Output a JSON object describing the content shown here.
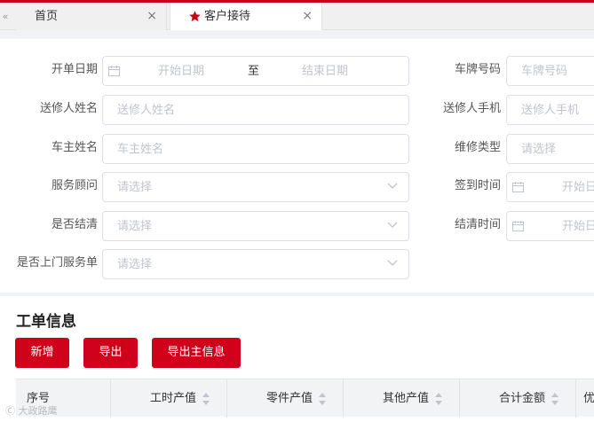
{
  "tabs": {
    "scroll_left": "«",
    "home_label": "首页",
    "active_label": "客户接待",
    "close": "×"
  },
  "filters": {
    "order_date": {
      "label": "开单日期",
      "start_placeholder": "开始日期",
      "separator": "至",
      "end_placeholder": "结束日期"
    },
    "plate": {
      "label": "车牌号码",
      "placeholder": "车牌号码"
    },
    "sender_name": {
      "label": "送修人姓名",
      "placeholder": "送修人姓名"
    },
    "sender_phone": {
      "label": "送修人手机",
      "placeholder": "送修人手机"
    },
    "owner_name": {
      "label": "车主姓名",
      "placeholder": "车主姓名"
    },
    "repair_type": {
      "label": "维修类型",
      "placeholder": "请选择"
    },
    "advisor": {
      "label": "服务顾问",
      "placeholder": "请选择"
    },
    "checkin_time": {
      "label": "签到时间",
      "placeholder": "开始日"
    },
    "settled": {
      "label": "是否结清",
      "placeholder": "请选择"
    },
    "settle_time": {
      "label": "结清时间",
      "placeholder": "开始日"
    },
    "onsite": {
      "label": "是否上门服务单",
      "placeholder": "请选择"
    }
  },
  "work_orders": {
    "title": "工单信息",
    "buttons": {
      "add": "新增",
      "export": "导出",
      "export_main": "导出主信息"
    },
    "columns": [
      "序号",
      "工时产值",
      "零件产值",
      "其他产值",
      "合计金额",
      "优"
    ]
  },
  "watermark": "Ⓒ 大政路鹰",
  "colors": {
    "accent": "#d0021b",
    "border": "#dcdfe6",
    "placeholder": "#c0c4cc"
  }
}
